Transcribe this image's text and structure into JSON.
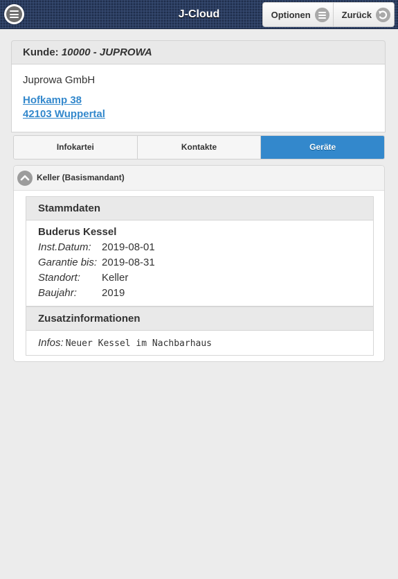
{
  "header": {
    "title": "J-Cloud",
    "options_label": "Optionen",
    "back_label": "Zurück"
  },
  "customer": {
    "label": "Kunde:",
    "id_name": "10000 - JUPROWA",
    "company": "Juprowa GmbH",
    "street": "Hofkamp 38",
    "city": "42103 Wuppertal"
  },
  "tabs": [
    {
      "label": "Infokartei",
      "active": false
    },
    {
      "label": "Kontakte",
      "active": false
    },
    {
      "label": "Geräte",
      "active": true
    }
  ],
  "device_group": {
    "title": "Keller (Basismandant)",
    "stammdaten": {
      "heading": "Stammdaten",
      "device_name": "Buderus Kessel",
      "rows": [
        {
          "key": "Inst.Datum:",
          "value": "2019-08-01"
        },
        {
          "key": "Garantie bis:",
          "value": "2019-08-31"
        },
        {
          "key": "Standort:",
          "value": "Keller"
        },
        {
          "key": "Baujahr:",
          "value": "2019"
        }
      ]
    },
    "zusatz": {
      "heading": "Zusatzinformationen",
      "infos_key": "Infos:",
      "infos_value": "Neuer Kessel im Nachbarhaus"
    }
  },
  "colors": {
    "accent": "#3388cc",
    "header_bg": "#2b3e63",
    "page_bg": "#ececec"
  }
}
